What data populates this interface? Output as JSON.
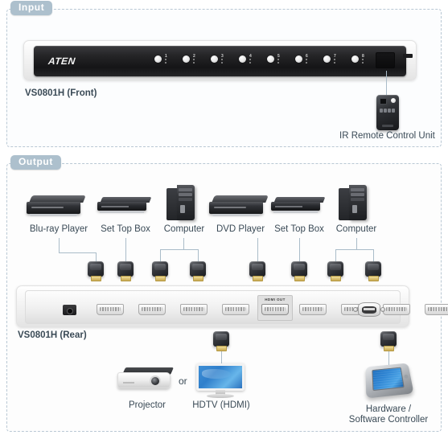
{
  "sections": {
    "input": {
      "badge": "Input"
    },
    "output": {
      "badge": "Output"
    }
  },
  "input_section": {
    "device_label": "VS0801H (Front)",
    "brand": "ATEN",
    "front_buttons": [
      {
        "number": "1"
      },
      {
        "number": "2"
      },
      {
        "number": "3"
      },
      {
        "number": "4"
      },
      {
        "number": "5"
      },
      {
        "number": "6"
      },
      {
        "number": "7"
      },
      {
        "number": "8"
      }
    ],
    "remote_label": "IR Remote Control Unit"
  },
  "output_section": {
    "device_label": "VS0801H (Rear)",
    "hdmi_out_label": "HDMI OUT",
    "sources": [
      {
        "name": "Blu-ray Player",
        "type": "player"
      },
      {
        "name": "Set Top Box",
        "type": "stb"
      },
      {
        "name": "Computer",
        "type": "tower"
      },
      {
        "name": "DVD Player",
        "type": "player"
      },
      {
        "name": "Set Top Box",
        "type": "stb"
      },
      {
        "name": "Computer",
        "type": "tower"
      }
    ],
    "destinations": {
      "projector": "Projector",
      "or": "or",
      "hdtv": "HDTV (HDMI)",
      "controller_line1": "Hardware /",
      "controller_line2": "Software Controller"
    }
  },
  "colors": {
    "badge_bg": "#adc0cd",
    "section_border": "#b9c8d4",
    "label_text": "#3a4a56",
    "line": "#aabcc9",
    "screen_blue": "#2f7fcb",
    "gold_contact": "#c9a94f"
  }
}
